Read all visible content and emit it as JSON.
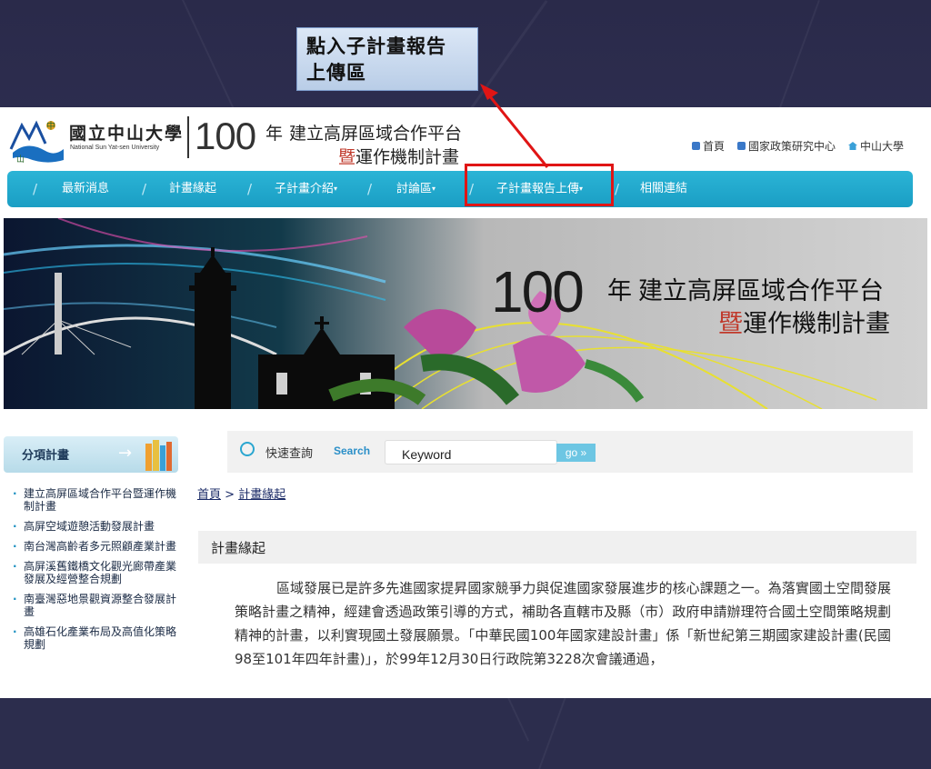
{
  "callout": {
    "line1": "點入子計畫報告",
    "line2": "上傳區"
  },
  "header": {
    "uni_name": "國立中山大學",
    "uni_en": "National Sun Yat-sen University",
    "num": "100",
    "nian": "年",
    "title1": "建立高屏區域合作平台",
    "title2_first": "暨",
    "title2_rest": "運作機制計畫",
    "toplinks": [
      "首頁",
      "國家政策研究中心",
      "中山大學"
    ]
  },
  "nav": {
    "items": [
      "最新消息",
      "計畫緣起",
      "子計畫介紹",
      "討論區",
      "子計畫報告上傳",
      "相關連結"
    ],
    "dropdown_marker": "▾"
  },
  "banner": {
    "num": "100",
    "nian": "年",
    "title1": "建立高屏區域合作平台",
    "title2_first": "暨",
    "title2_rest": "運作機制計畫"
  },
  "sidebar": {
    "heading": "分項計畫",
    "arrow": "→",
    "items": [
      "建立高屏區域合作平台暨運作機制計畫",
      "高屏空域遊憩活動發展計畫",
      "南台灣高齡者多元照顧產業計畫",
      "高屏溪舊鐵橋文化觀光廊帶產業發展及經營整合規劃",
      "南臺灣惡地景觀資源整合發展計畫",
      "高雄石化產業布局及高值化策略規劃"
    ]
  },
  "search": {
    "quick_label": "快速查詢",
    "search_label": "Search",
    "placeholder": "Keyword",
    "go_label": "go »"
  },
  "breadcrumb": {
    "home": "首頁",
    "sep": " > ",
    "current": "計畫緣起"
  },
  "section": {
    "title": "計畫緣起",
    "body": "區域發展已是許多先進國家提昇國家競爭力與促進國家發展進步的核心課題之一。為落實國土空間發展策略計畫之精神，經建會透過政策引導的方式，補助各直轄市及縣（市）政府申請辦理符合國土空間策略規劃精神的計畫，以利實現國土發展願景。「中華民國100年國家建設計畫」係「新世紀第三期國家建設計畫(民國98至101年四年計畫)」，於99年12月30日行政院第3228次會議通過，"
  },
  "colors": {
    "nav": "#1a9ec4",
    "highlight": "#e01515",
    "slide_bg": "#2c2d4d"
  }
}
